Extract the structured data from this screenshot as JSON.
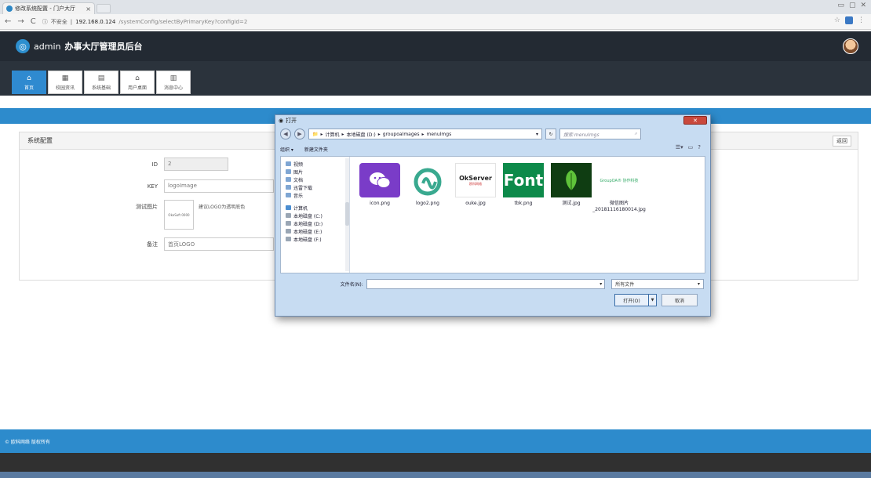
{
  "browser": {
    "tab_title": "修改系统配置 - 门户大厅",
    "tab_close": "×",
    "security_label": "不安全",
    "url_host": "192.168.0.124",
    "url_path": "/systemConfig/selectByPrimaryKey?configId=2"
  },
  "header": {
    "logo_glyph": "◎",
    "user": "admin",
    "title": "办事大厅管理员后台"
  },
  "modules": [
    {
      "label": "首页",
      "icon": "home-icon",
      "active": true
    },
    {
      "label": "校园资讯",
      "icon": "news-icon",
      "active": false
    },
    {
      "label": "系统基础",
      "icon": "grid-icon",
      "active": false
    },
    {
      "label": "用户桌面",
      "icon": "desktop-icon",
      "active": false
    },
    {
      "label": "消息中心",
      "icon": "message-icon",
      "active": false
    }
  ],
  "panel": {
    "title": "系统配置",
    "back_label": "返回",
    "fields": {
      "id_label": "ID",
      "id_value": "2",
      "key_label": "KEY",
      "key_value": "logoImage",
      "img_label": "测试图片",
      "img_hint": "建议LOGO为透明底色",
      "img_thumb_text": "OkeSoft 0000",
      "note_label": "备注",
      "note_value": "首页LOGO"
    }
  },
  "footer": {
    "text": "© 欧科网络 版权所有"
  },
  "dialog": {
    "title": "打开",
    "close_label": "✕",
    "breadcrumb": [
      "计算机",
      "本地磁盘 (D:)",
      "groupoaImages",
      "menuImgs"
    ],
    "search_placeholder": "搜索 menuImgs",
    "organize_label": "组织 ▾",
    "new_folder_label": "新建文件夹",
    "tree": [
      {
        "label": "视频",
        "type": "lib"
      },
      {
        "label": "图片",
        "type": "lib"
      },
      {
        "label": "文档",
        "type": "lib"
      },
      {
        "label": "迅雷下载",
        "type": "lib"
      },
      {
        "label": "音乐",
        "type": "lib"
      },
      {
        "label": "计算机",
        "type": "comp"
      },
      {
        "label": "本地磁盘 (C:)",
        "type": "drive"
      },
      {
        "label": "本地磁盘 (D:)",
        "type": "drive"
      },
      {
        "label": "本地磁盘 (E:)",
        "type": "drive"
      },
      {
        "label": "本地磁盘 (F:)",
        "type": "drive"
      }
    ],
    "files": [
      {
        "name": "icon.png",
        "kind": "chat"
      },
      {
        "name": "logo2.png",
        "kind": "logo2"
      },
      {
        "name": "ouke.jpg",
        "kind": "ouke"
      },
      {
        "name": "tbk.png",
        "kind": "font"
      },
      {
        "name": "测试.jpg",
        "kind": "leaf"
      },
      {
        "name": "微信图片_20181116180014.jpg",
        "kind": "gq"
      }
    ],
    "ouke_thumb": "OkServer",
    "ouke_sub": "欧科网络",
    "font_thumb": "Font",
    "gq_thumb": "GroupOA® 协作科技",
    "filename_label": "文件名(N):",
    "filter_value": "所有文件",
    "open_label": "打开(O)",
    "cancel_label": "取消"
  }
}
